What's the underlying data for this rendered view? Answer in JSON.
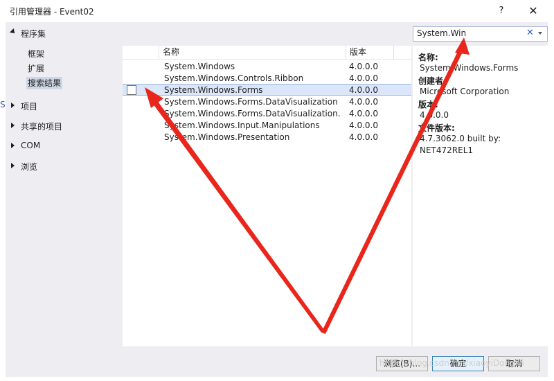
{
  "window": {
    "title": "引用管理器 - Event02",
    "help": "?",
    "close": "✕"
  },
  "left": {
    "header": "程序集",
    "subitems": [
      "框架",
      "扩展",
      "搜索结果"
    ],
    "categories": [
      "项目",
      "共享的项目",
      "COM",
      "浏览"
    ],
    "fragment": "S"
  },
  "list": {
    "columns": [
      "名称",
      "版本"
    ],
    "rows": [
      {
        "name": "System.Windows",
        "version": "4.0.0.0"
      },
      {
        "name": "System.Windows.Controls.Ribbon",
        "version": "4.0.0.0"
      },
      {
        "name": "System.Windows.Forms",
        "version": "4.0.0.0"
      },
      {
        "name": "System.Windows.Forms.DataVisualization",
        "version": "4.0.0.0"
      },
      {
        "name": "System.Windows.Forms.DataVisualization....",
        "version": "4.0.0.0"
      },
      {
        "name": "System.Windows.Input.Manipulations",
        "version": "4.0.0.0"
      },
      {
        "name": "System.Windows.Presentation",
        "version": "4.0.0.0"
      }
    ]
  },
  "search": {
    "value": "System.Win",
    "clear": "✕"
  },
  "details": {
    "name_label": "名称:",
    "name_value": "System.Windows.Forms",
    "creator_label": "创建者:",
    "creator_value": "Microsoft Corporation",
    "version_label": "版本:",
    "version_value": "4.0.0.0",
    "file_version_label": "文件版本:",
    "file_version_value_1": "4.7.3062.0 built by:",
    "file_version_value_2": "NET472REL1"
  },
  "buttons": {
    "browse": "浏览(B)...",
    "ok": "确定",
    "cancel": "取消"
  },
  "watermark": "https://blog.csdn.net/xiaoyiDongwi",
  "colors": {
    "annotation": "#e8261c",
    "selection": "#dbe6f8",
    "panel": "#eeeef2"
  }
}
